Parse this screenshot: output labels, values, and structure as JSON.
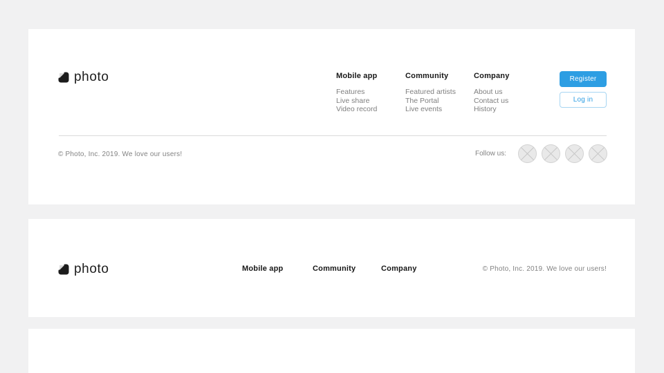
{
  "brand": {
    "name": "photo"
  },
  "colors": {
    "accent": "#2d9ee3",
    "page_background": "#f1f1f2",
    "card_background": "#ffffff",
    "heading_text": "#171717",
    "link_text": "#7f7f7f",
    "muted_text": "#828282",
    "divider": "#d9d9d9"
  },
  "footer_full": {
    "columns": [
      {
        "title": "Mobile app",
        "links": [
          "Features",
          "Live share",
          "Video record"
        ]
      },
      {
        "title": "Community",
        "links": [
          "Featured artists",
          "The Portal",
          "Live events"
        ]
      },
      {
        "title": "Company",
        "links": [
          "About us",
          "Contact us",
          "History"
        ]
      }
    ],
    "register_label": "Register",
    "login_label": "Log in",
    "copyright": "© Photo, Inc. 2019. We love our users!",
    "follow_label": "Follow us:",
    "social_icons": [
      "social-placeholder",
      "social-placeholder",
      "social-placeholder",
      "social-placeholder"
    ]
  },
  "footer_compact": {
    "links": [
      "Mobile app",
      "Community",
      "Company"
    ],
    "copyright": "© Photo, Inc. 2019. We love our users!"
  }
}
